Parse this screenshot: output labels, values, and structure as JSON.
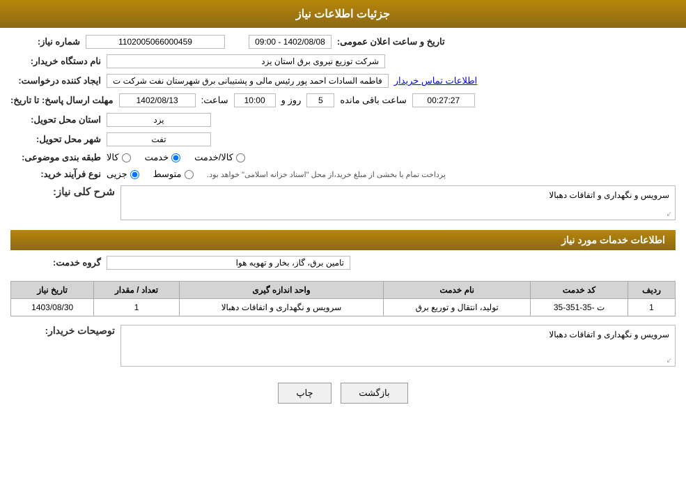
{
  "header": {
    "title": "جزئیات اطلاعات نیاز"
  },
  "fields": {
    "shomara_niaz_label": "شماره نیاز:",
    "shomara_niaz_value": "1102005066000459",
    "nam_dastgah_label": "نام دستگاه خریدار:",
    "nam_dastgah_value": "شرکت توزیع نیروی برق استان یزد",
    "ijad_konande_label": "ایجاد کننده درخواست:",
    "ijad_konande_value": "فاطمه السادات  احمد پور  رئیس مالی و پشتیبانی برق شهرستان نفت شرکت ت",
    "ijad_konande_link": "اطلاعات تماس خریدار",
    "mohlat_ersal_label": "مهلت ارسال پاسخ: تا تاریخ:",
    "mohlat_date": "1402/08/13",
    "mohlat_saat_label": "ساعت:",
    "mohlat_saat": "10:00",
    "mohlat_rooz_label": "روز و",
    "mohlat_rooz": "5",
    "mohlat_baqi_label": "ساعت باقی مانده",
    "mohlat_baqi": "00:27:27",
    "tarikh_elan_label": "تاریخ و ساعت اعلان عمومی:",
    "tarikh_elan_value": "1402/08/08 - 09:00",
    "ostan_label": "استان محل تحویل:",
    "ostan_value": "یزد",
    "shahr_label": "شهر محل تحویل:",
    "shahr_value": "تفت",
    "tabaqe_label": "طبقه بندی موضوعی:",
    "tabaqe_kala": "کالا",
    "tabaqe_khadamat": "خدمت",
    "tabaqe_kala_khadamat": "کالا/خدمت",
    "noe_farayand_label": "نوع فرآیند خرید:",
    "noe_jozii": "جزیی",
    "noe_motovaset": "متوسط",
    "noe_desc": "پرداخت تمام یا بخشی از مبلغ خرید،از محل \"اسناد خزانه اسلامی\" خواهد بود.",
    "sharh_koli_label": "شرح کلی نیاز:",
    "sharh_koli_value": "سرویس و نگهداری و اتفاقات دهبالا",
    "khadamat_info_label": "اطلاعات خدمات مورد نیاز",
    "grohe_khadamat_label": "گروه خدمت:",
    "grohe_khadamat_value": "تامین برق، گاز، بخار و تهویه هوا"
  },
  "table": {
    "headers": [
      "ردیف",
      "کد خدمت",
      "نام خدمت",
      "واحد اندازه گیری",
      "تعداد / مقدار",
      "تاریخ نیاز"
    ],
    "rows": [
      {
        "radif": "1",
        "kod": "ت -35-351-35",
        "nam": "تولید، انتقال و توریع برق",
        "vahed": "سرویس و نگهداری و اتفاقات دهبالا",
        "tedad": "1",
        "tarikh": "1403/08/30"
      }
    ]
  },
  "description": {
    "label": "توصیحات خریدار:",
    "value": "سرویس و نگهداری و اتفاقات دهبالا"
  },
  "buttons": {
    "print": "چاپ",
    "back": "بازگشت"
  }
}
